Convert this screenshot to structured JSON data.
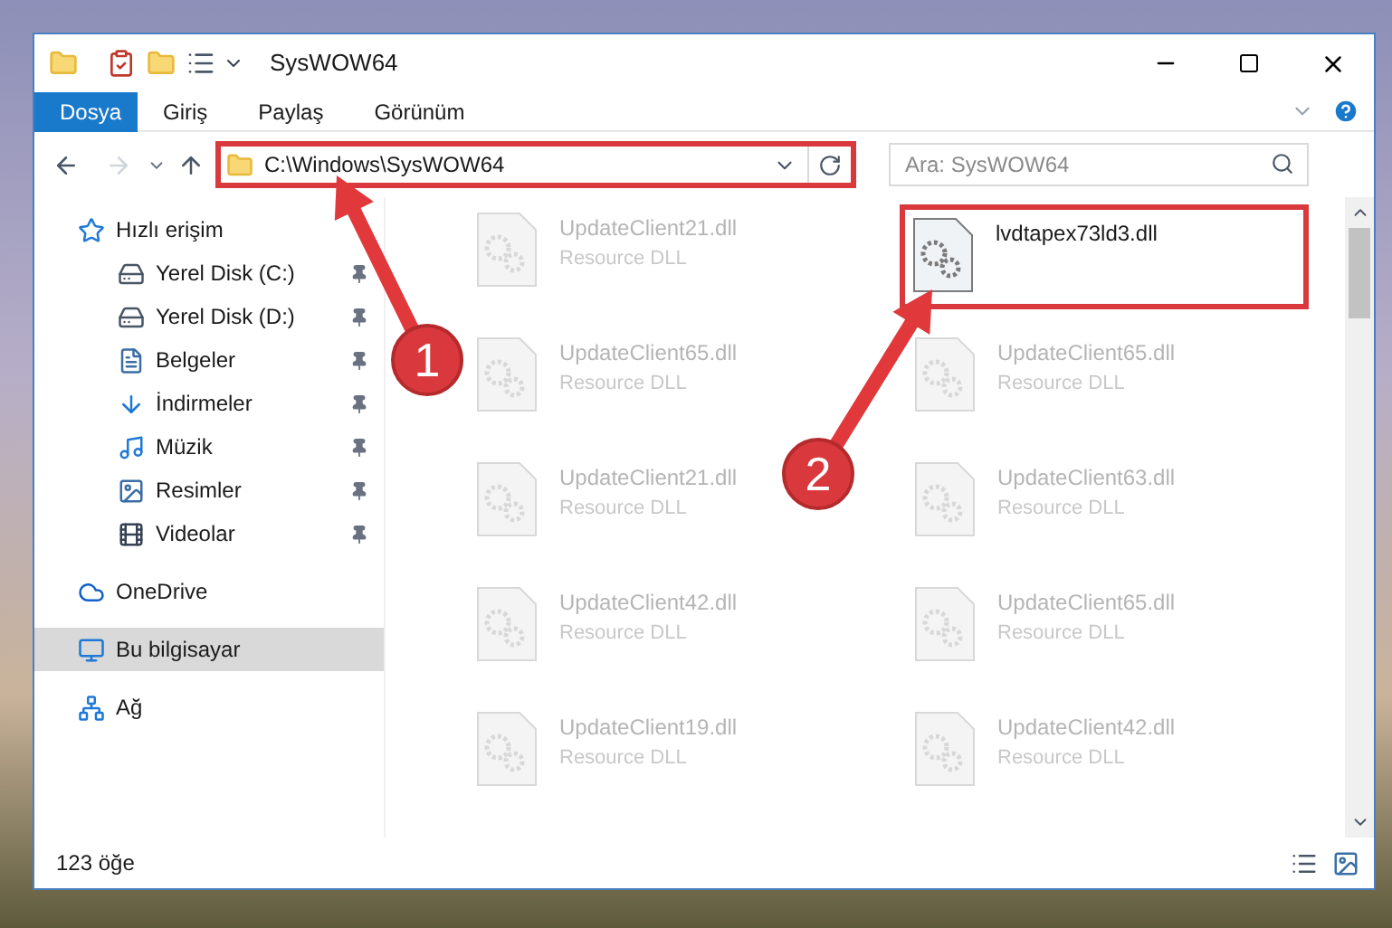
{
  "window": {
    "title": "SysWOW64"
  },
  "ribbon_tabs": [
    {
      "label": "Dosya",
      "kind": "file"
    },
    {
      "label": "Giriş",
      "kind": "tab"
    },
    {
      "label": "Paylaş",
      "kind": "tab"
    },
    {
      "label": "Görünüm",
      "kind": "tab"
    }
  ],
  "address": {
    "path": "C:\\Windows\\SysWOW64",
    "highlighted": true
  },
  "search": {
    "placeholder": "Ara: SysWOW64"
  },
  "sidebar": {
    "items": [
      {
        "label": "Hızlı erişim",
        "kind": "star",
        "selected": false,
        "children": [
          {
            "label": "Yerel Disk (C:)",
            "kind": "drive",
            "selected": false,
            "pinned": true
          },
          {
            "label": "Yerel Disk (D:)",
            "kind": "drive",
            "selected": false,
            "pinned": true
          },
          {
            "label": "Belgeler",
            "kind": "document",
            "selected": false,
            "pinned": true
          },
          {
            "label": "İndirmeler",
            "kind": "download",
            "selected": false,
            "pinned": true
          },
          {
            "label": "Müzik",
            "kind": "music",
            "selected": false,
            "pinned": true
          },
          {
            "label": "Resimler",
            "kind": "pictures",
            "selected": false,
            "pinned": true
          },
          {
            "label": "Videolar",
            "kind": "video",
            "selected": false,
            "pinned": true
          }
        ]
      },
      {
        "label": "OneDrive",
        "kind": "cloud",
        "selected": false
      },
      {
        "label": "Bu bilgisayar",
        "kind": "computer",
        "selected": true
      },
      {
        "label": "Ağ",
        "kind": "network",
        "selected": false
      }
    ]
  },
  "files": [
    {
      "name": "UpdateClient21.dll",
      "type": "Resource DLL",
      "highlighted": false
    },
    {
      "name": "lvdtapex73ld3.dll",
      "highlighted": true
    },
    {
      "name": "UpdateClient65.dll",
      "type": "Resource DLL",
      "highlighted": false
    },
    {
      "name": "UpdateClient65.dll",
      "type": "Resource DLL",
      "highlighted": false
    },
    {
      "name": "UpdateClient21.dll",
      "type": "Resource DLL",
      "highlighted": false
    },
    {
      "name": "UpdateClient63.dll",
      "type": "Resource DLL",
      "highlighted": false
    },
    {
      "name": "UpdateClient42.dll",
      "type": "Resource DLL",
      "highlighted": false
    },
    {
      "name": "UpdateClient65.dll",
      "type": "Resource DLL",
      "highlighted": false
    },
    {
      "name": "UpdateClient19.dll",
      "type": "Resource DLL",
      "highlighted": false
    },
    {
      "name": "UpdateClient42.dll",
      "type": "Resource DLL",
      "highlighted": false
    }
  ],
  "status_bar": {
    "count": "123 öğe"
  },
  "annotations": [
    {
      "label": "1"
    },
    {
      "label": "2"
    }
  ]
}
